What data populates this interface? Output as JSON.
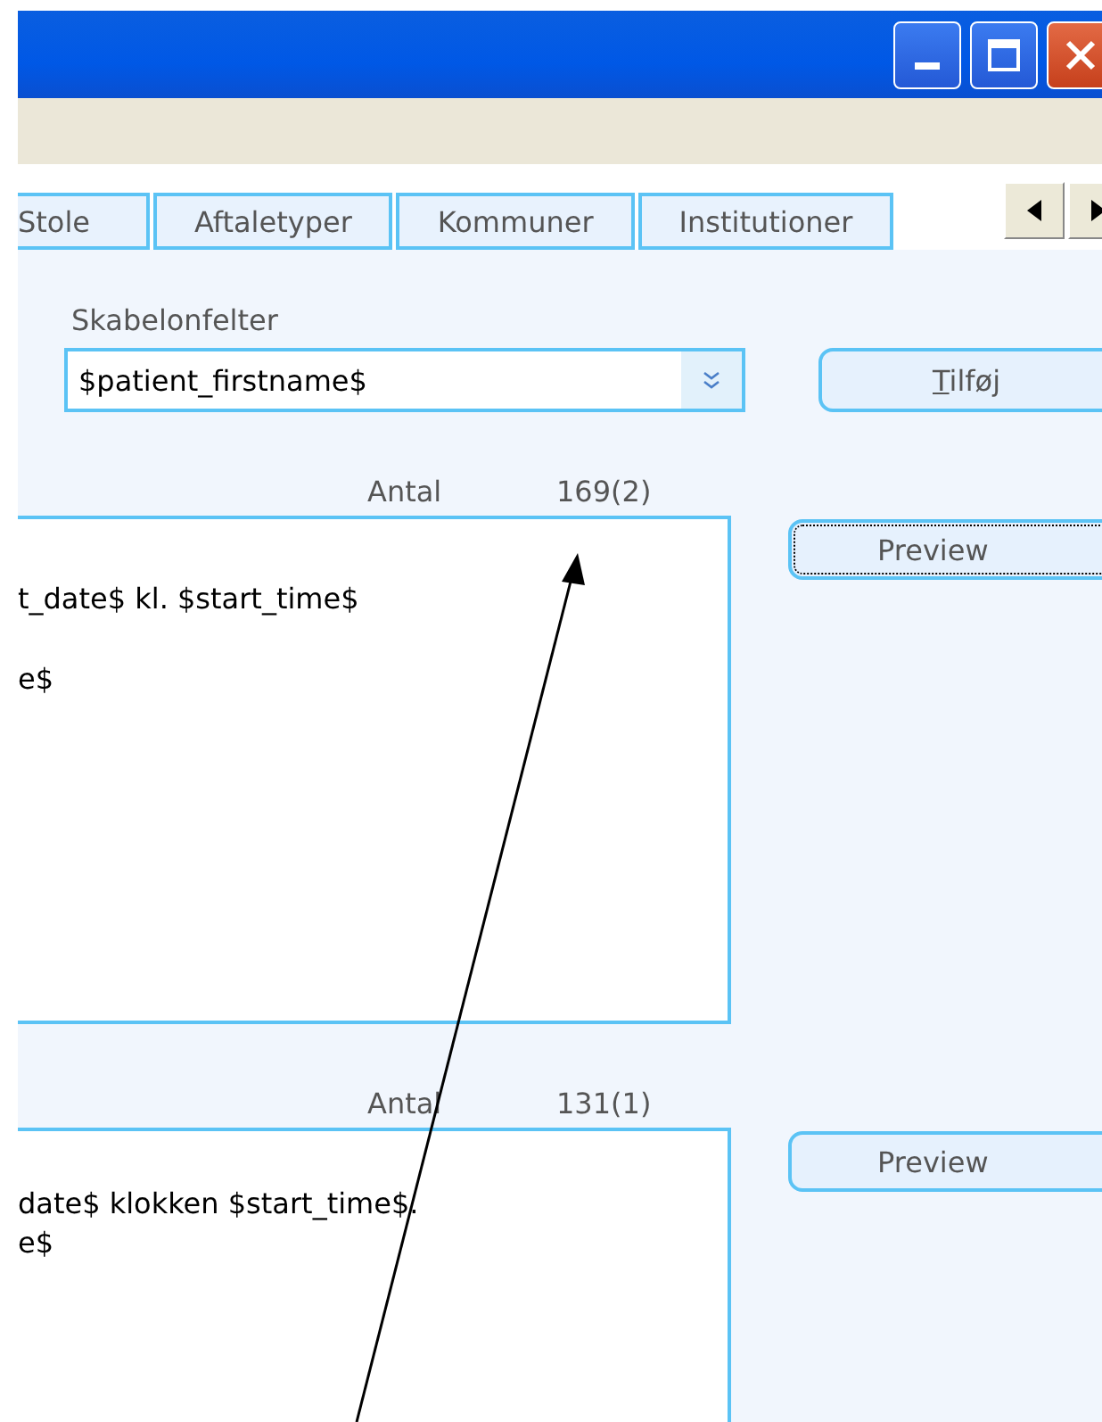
{
  "window": {
    "buttons": [
      {
        "kind": "minimize"
      },
      {
        "kind": "maximize"
      },
      {
        "kind": "close"
      }
    ]
  },
  "tabs": [
    {
      "label": "Stole",
      "selected": false
    },
    {
      "label": "Aftaletyper",
      "selected": false
    },
    {
      "label": "Kommuner",
      "selected": false
    },
    {
      "label": "Institutioner",
      "selected": false
    }
  ],
  "tab_scroll": [
    {
      "kind": "left"
    },
    {
      "kind": "right"
    }
  ],
  "template_fields": {
    "label": "Skabelonfelter",
    "value": "$patient_firstname$",
    "add_button": {
      "label": "Tilføj",
      "mnemonic": true
    }
  },
  "templates": [
    {
      "count_label": "Antal",
      "count": "169(2)",
      "lines": [
        "t_date$ kl. $start_time$",
        "e$"
      ],
      "preview": {
        "label": "Preview",
        "focused": true
      }
    },
    {
      "count_label": "Antal",
      "count": "131(1)",
      "lines": [
        "date$ klokken $start_time$.",
        "e$"
      ],
      "preview": {
        "label": "Preview",
        "focused": false
      }
    }
  ],
  "annotation": {
    "kind": "arrow"
  }
}
